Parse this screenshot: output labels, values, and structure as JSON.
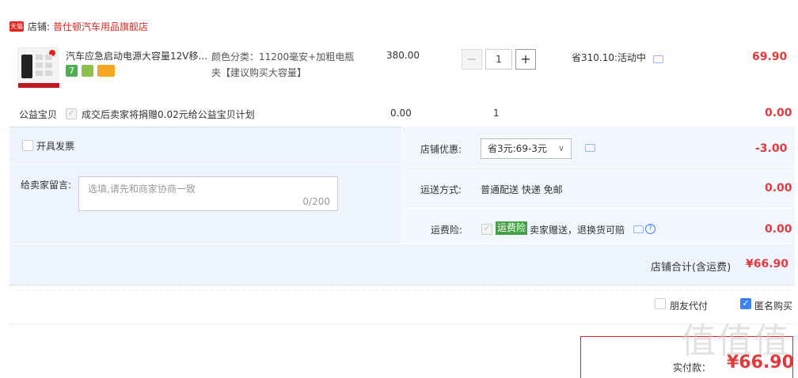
{
  "store": {
    "logo_text": "天猫",
    "prefix": "店铺:",
    "name": "普仕顿汽车用品旗舰店"
  },
  "item": {
    "title": "汽车应急启动电源大容量12V移...",
    "badges": [
      "7",
      "",
      ""
    ],
    "sku_line1": "颜色分类：11200毫安+加粗电瓶",
    "sku_line2": "夹【建议购买大容量】",
    "unit_price": "380.00",
    "qty_minus": "−",
    "quantity": "1",
    "qty_plus": "+",
    "promo": "省310.10:活动中",
    "subtotal": "69.90"
  },
  "charity": {
    "label": "公益宝贝",
    "text": "成交后卖家将捐赠0.02元给公益宝贝计划",
    "price": "0.00",
    "qty": "1",
    "subtotal": "0.00"
  },
  "invoice": {
    "label": "开具发票"
  },
  "memo": {
    "label": "给卖家留言:",
    "placeholder": "选填,请先和商家协商一致",
    "counter": "0/200"
  },
  "store_discount": {
    "label": "店铺优惠:",
    "selected": "省3元:69-3元",
    "amount": "-3.00"
  },
  "shipping": {
    "label": "运送方式:",
    "value": "普通配送 快递 免邮",
    "amount": "0.00"
  },
  "insurance": {
    "label": "运费险:",
    "tag": "运费险",
    "text": "卖家赠送，退换货可赔",
    "amount": "0.00"
  },
  "store_total": {
    "label": "店铺合计(含运费)",
    "amount": "¥66.90"
  },
  "options": {
    "friend_pay": "朋友代付",
    "anonymous": "匿名购买"
  },
  "payment": {
    "label": "实付款：",
    "amount": "¥66.90"
  },
  "watermark": "值值值",
  "colors": {
    "accent_red": "#e4393c",
    "store_red": "#e2231a",
    "panel_blue": "#eef4fd",
    "check_blue": "#3b82f6"
  }
}
